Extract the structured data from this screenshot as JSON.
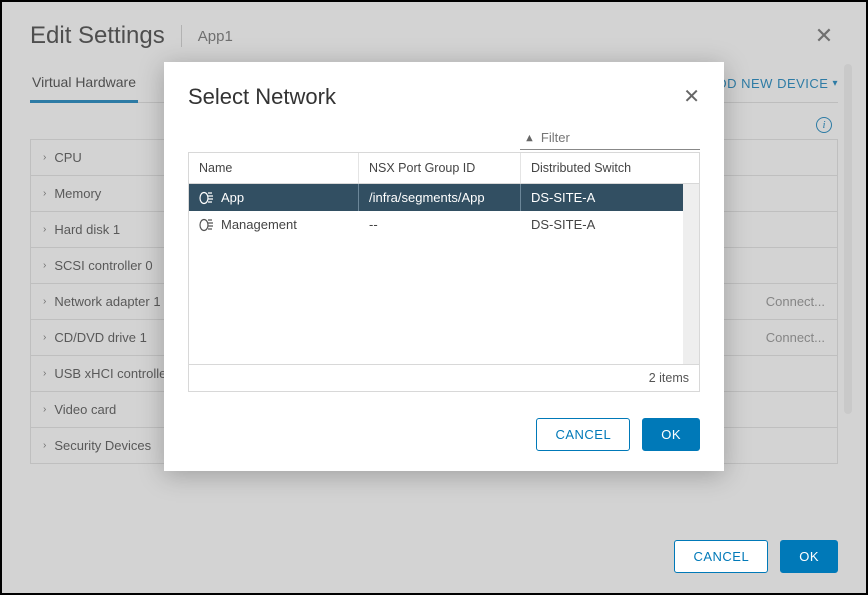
{
  "edit": {
    "title": "Edit Settings",
    "subtitle": "App1",
    "tab": "Virtual Hardware",
    "addDevice": "ADD NEW DEVICE",
    "items": [
      {
        "label": "CPU",
        "extra": ""
      },
      {
        "label": "Memory",
        "extra": ""
      },
      {
        "label": "Hard disk 1",
        "extra": ""
      },
      {
        "label": "SCSI controller 0",
        "extra": ""
      },
      {
        "label": "Network adapter 1",
        "extra": "Connect..."
      },
      {
        "label": "CD/DVD drive 1",
        "extra": "Connect..."
      },
      {
        "label": "USB xHCI controller",
        "extra": ""
      },
      {
        "label": "Video card",
        "extra": ""
      },
      {
        "label": "Security Devices",
        "extra": ""
      }
    ],
    "cancel": "CANCEL",
    "ok": "OK"
  },
  "modal": {
    "title": "Select Network",
    "filterPlaceholder": "Filter",
    "columns": {
      "name": "Name",
      "port": "NSX Port Group ID",
      "switch": "Distributed Switch"
    },
    "rows": [
      {
        "name": "App",
        "port": "/infra/segments/App",
        "switch": "DS-SITE-A",
        "selected": true
      },
      {
        "name": "Management",
        "port": "--",
        "switch": "DS-SITE-A",
        "selected": false
      }
    ],
    "footer": "2 items",
    "cancel": "CANCEL",
    "ok": "OK"
  }
}
